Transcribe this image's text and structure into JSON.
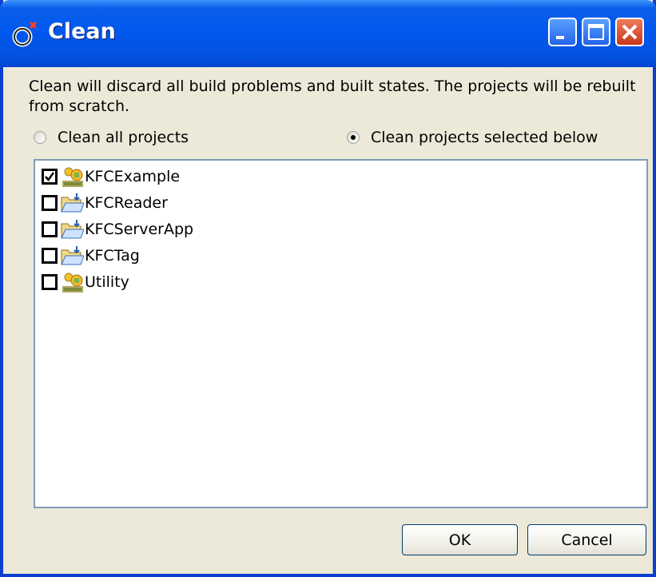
{
  "window": {
    "title": "Clean"
  },
  "description": "Clean will discard all build problems and built states.  The projects will be rebuilt from scratch.",
  "options": {
    "clean_all": {
      "label": "Clean all projects",
      "selected": false
    },
    "clean_selected": {
      "label": "Clean projects selected below",
      "selected": true
    }
  },
  "projects": [
    {
      "label": "KFCExample",
      "checked": true,
      "icon": "java-project-icon"
    },
    {
      "label": "KFCReader",
      "checked": false,
      "icon": "folder-project-icon"
    },
    {
      "label": "KFCServerApp",
      "checked": false,
      "icon": "folder-project-icon"
    },
    {
      "label": "KFCTag",
      "checked": false,
      "icon": "folder-project-icon"
    },
    {
      "label": "Utility",
      "checked": false,
      "icon": "java-project-icon"
    }
  ],
  "buttons": {
    "ok": "OK",
    "cancel": "Cancel"
  },
  "colors": {
    "titlebar": "#0058ee",
    "dialog_bg": "#ece9d8",
    "list_border": "#7f9db9",
    "close_button": "#c9371d"
  }
}
